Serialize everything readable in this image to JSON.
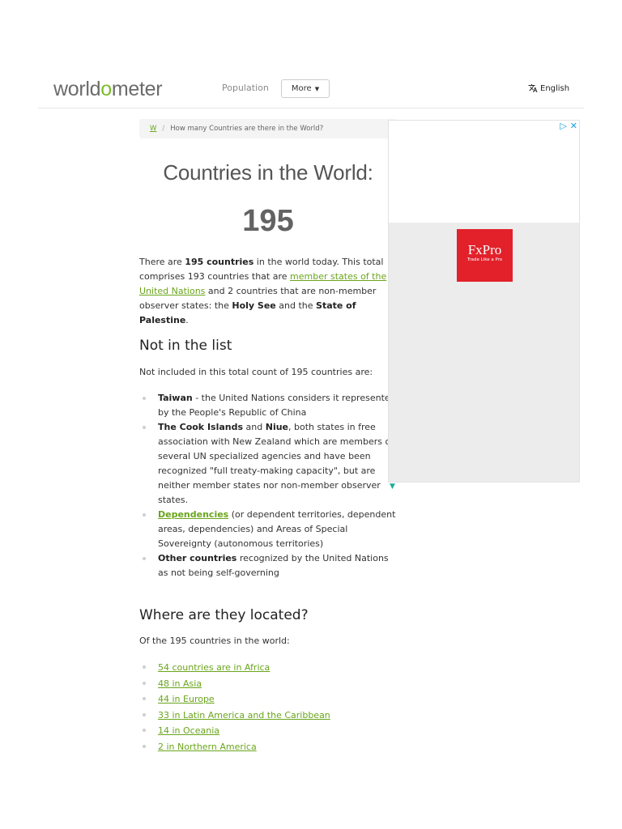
{
  "header": {
    "logo_left": "worldometer",
    "nav_population": "Population",
    "more_label": "More",
    "language": "English"
  },
  "breadcrumb": {
    "home": "W",
    "current": "How many Countries are there in the World?"
  },
  "main": {
    "title": "Countries in the World:",
    "count": "195",
    "intro": {
      "t1": "There are ",
      "b1": "195 countries",
      "t2": " in the world today. This total comprises 193 countries that are ",
      "link": "member states of the United Nations",
      "t3": " and 2 countries that are non-member observer states: the ",
      "b2": "Holy See",
      "t4": " and the ",
      "b3": "State of Palestine",
      "t5": "."
    },
    "not_in_list": {
      "heading": "Not in the list",
      "intro": "Not included in this total count of 195 countries are:",
      "items": [
        {
          "bold": "Taiwan",
          "text": " - the United Nations considers it represented by the People's Republic of China"
        },
        {
          "bold": "The Cook Islands",
          "mid": " and ",
          "bold2": "Niue",
          "text": ", both states in free association with New Zealand which are members of several UN specialized agencies and have been recognized \"full treaty-making capacity\", but are neither member states nor non-member observer states."
        },
        {
          "link": "Dependencies",
          "text": " (or dependent territories, dependent areas, dependencies) and Areas of Special Sovereignty (autonomous territories)"
        },
        {
          "bold": "Other countries",
          "text": " recognized by the United Nations as not being self-governing"
        }
      ]
    },
    "located": {
      "heading": "Where are they located?",
      "intro": "Of the 195 countries in the world:",
      "links": [
        "54 countries are in Africa",
        "48 in Asia",
        "44 in Europe",
        "33 in Latin America and the Caribbean",
        "14 in Oceania",
        "2 in Northern America"
      ]
    }
  },
  "ad": {
    "brand": "FxPro",
    "tagline": "Trade Like a Pro",
    "play_icon": "▷",
    "close_icon": "✕"
  },
  "colors": {
    "accent": "#6aa51c",
    "logo_o": "#7cbd2b",
    "ad_red": "#e2212a"
  }
}
